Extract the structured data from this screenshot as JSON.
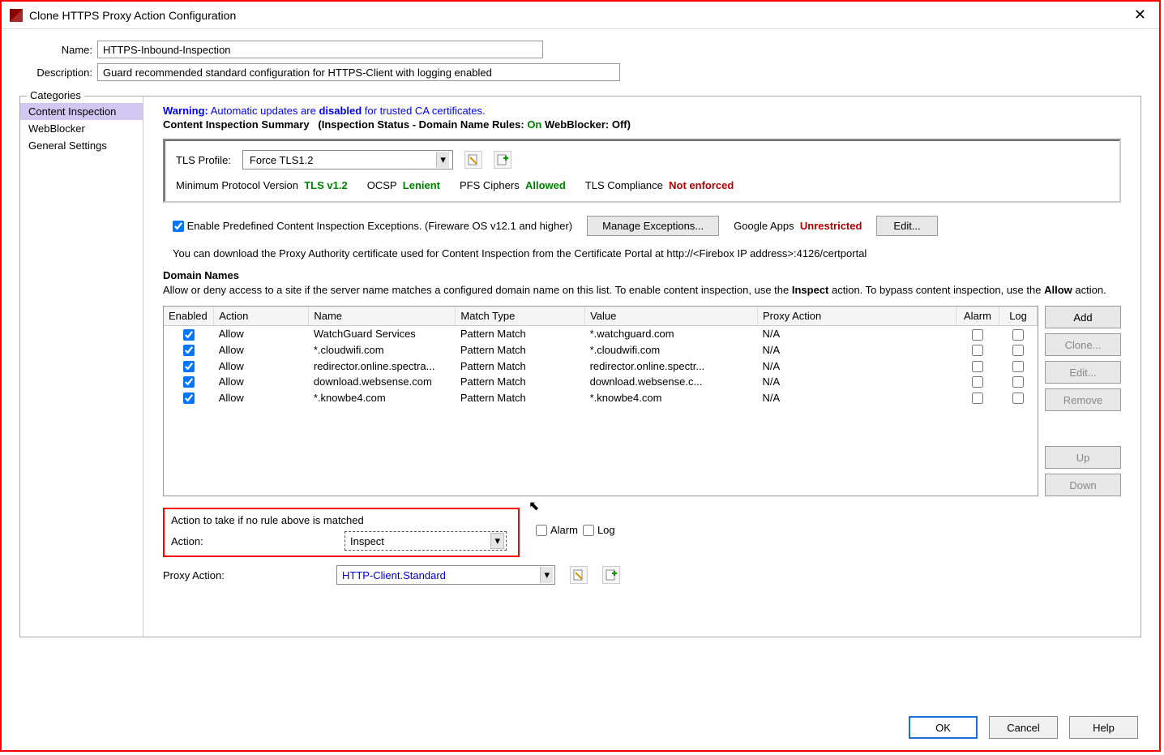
{
  "window": {
    "title": "Clone HTTPS Proxy Action Configuration"
  },
  "form": {
    "name_label": "Name:",
    "name_value": "HTTPS-Inbound-Inspection",
    "desc_label": "Description:",
    "desc_value": "Guard recommended standard configuration for HTTPS-Client with logging enabled"
  },
  "categories": {
    "legend": "Categories",
    "items": [
      "Content Inspection",
      "WebBlocker",
      "General Settings"
    ]
  },
  "warning": {
    "prefix": "Warning:",
    "text": " Automatic updates are ",
    "bold": "disabled",
    "suffix": " for trusted CA certificates."
  },
  "summary": {
    "title": "Content Inspection Summary",
    "status_label": "(Inspection Status  -  Domain Name Rules:",
    "status_on": "On",
    "wb_label": "  WebBlocker:",
    "wb_off": "Off",
    "close": ")"
  },
  "tls": {
    "profile_label": "TLS Profile:",
    "profile_value": "Force TLS1.2",
    "min_label": "Minimum Protocol Version",
    "min_value": "TLS v1.2",
    "ocsp_label": "OCSP",
    "ocsp_value": "Lenient",
    "pfs_label": "PFS Ciphers",
    "pfs_value": "Allowed",
    "comp_label": "TLS Compliance",
    "comp_value": "Not enforced"
  },
  "exceptions": {
    "checkbox_label": "Enable Predefined Content Inspection Exceptions. (Fireware OS v12.1 and higher)",
    "manage_btn": "Manage Exceptions...",
    "google_label": "Google Apps",
    "google_value": "Unrestricted",
    "edit_btn": "Edit..."
  },
  "info_line": "You can download the Proxy Authority certificate used for Content Inspection from the Certificate Portal at http://<Firebox IP address>:4126/certportal",
  "domain": {
    "heading": "Domain Names",
    "help": "Allow or deny access to a site if the server name matches a configured domain name on this list. To enable content inspection, use the ",
    "inspect": "Inspect",
    "help2": " action. To bypass content inspection, use the ",
    "allow": "Allow",
    "help3": " action."
  },
  "table": {
    "headers": {
      "enabled": "Enabled",
      "action": "Action",
      "name": "Name",
      "match": "Match Type",
      "value": "Value",
      "proxy": "Proxy Action",
      "alarm": "Alarm",
      "log": "Log"
    },
    "rows": [
      {
        "enabled": true,
        "action": "Allow",
        "name": "WatchGuard Services",
        "match": "Pattern Match",
        "value": "*.watchguard.com",
        "proxy": "N/A",
        "alarm": false,
        "log": false
      },
      {
        "enabled": true,
        "action": "Allow",
        "name": "*.cloudwifi.com",
        "match": "Pattern Match",
        "value": "*.cloudwifi.com",
        "proxy": "N/A",
        "alarm": false,
        "log": false
      },
      {
        "enabled": true,
        "action": "Allow",
        "name": "redirector.online.spectra...",
        "match": "Pattern Match",
        "value": "redirector.online.spectr...",
        "proxy": "N/A",
        "alarm": false,
        "log": false
      },
      {
        "enabled": true,
        "action": "Allow",
        "name": "download.websense.com",
        "match": "Pattern Match",
        "value": "download.websense.c...",
        "proxy": "N/A",
        "alarm": false,
        "log": false
      },
      {
        "enabled": true,
        "action": "Allow",
        "name": "*.knowbe4.com",
        "match": "Pattern Match",
        "value": "*.knowbe4.com",
        "proxy": "N/A",
        "alarm": false,
        "log": false
      }
    ],
    "buttons": {
      "add": "Add",
      "clone": "Clone...",
      "edit": "Edit...",
      "remove": "Remove",
      "up": "Up",
      "down": "Down"
    }
  },
  "no_match": {
    "title": "Action to take if no rule above is matched",
    "action_label": "Action:",
    "action_value": "Inspect",
    "alarm": "Alarm",
    "log": "Log"
  },
  "proxy_action": {
    "label": "Proxy Action:",
    "value": "HTTP-Client.Standard"
  },
  "footer": {
    "ok": "OK",
    "cancel": "Cancel",
    "help": "Help"
  }
}
